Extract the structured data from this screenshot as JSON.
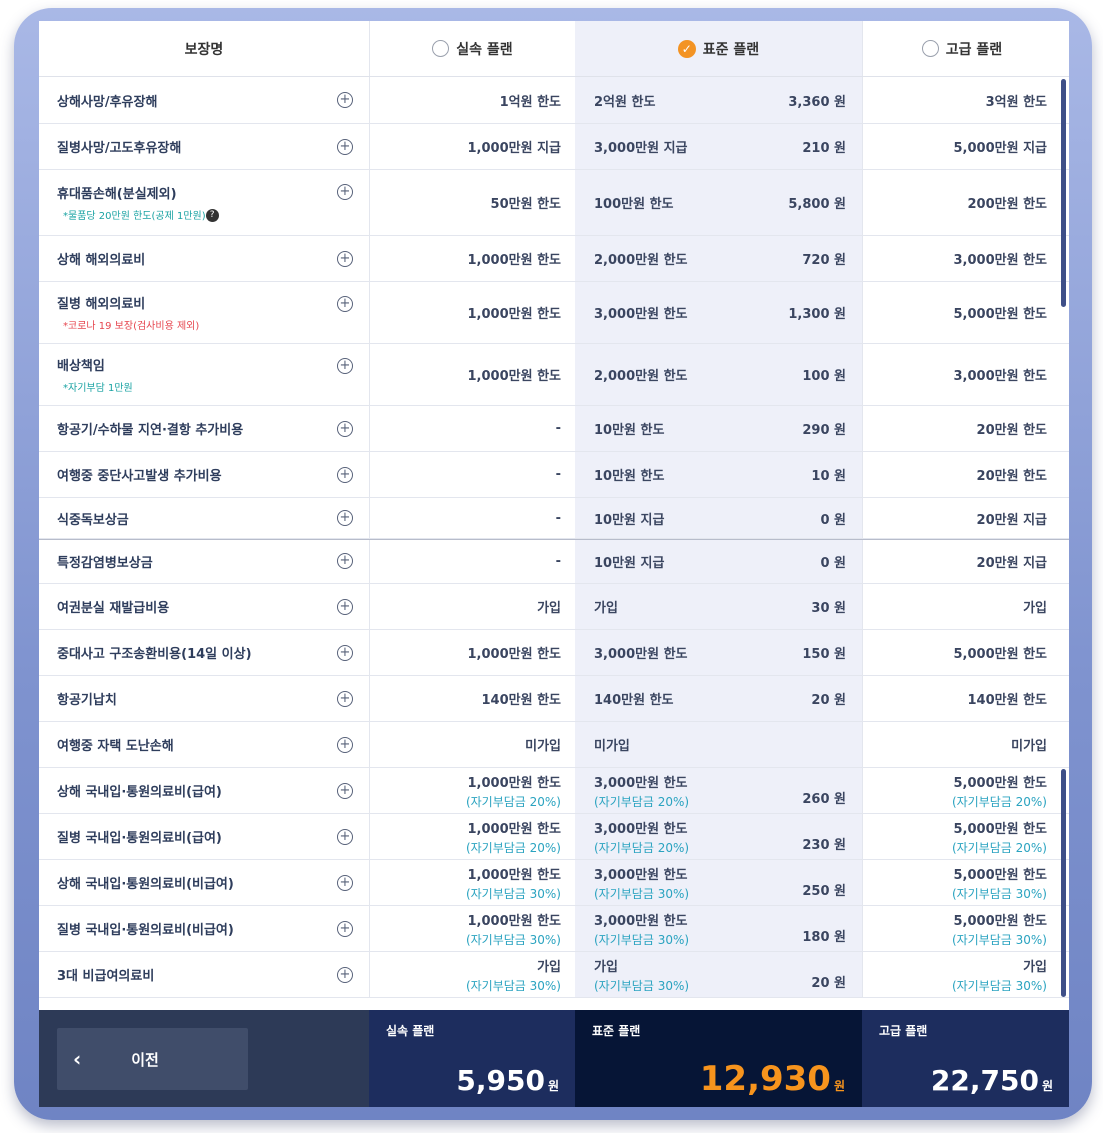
{
  "header": {
    "col0": "보장명",
    "plans": [
      {
        "label": "실속 플랜",
        "selected": false
      },
      {
        "label": "표준 플랜",
        "selected": true
      },
      {
        "label": "고급 플랜",
        "selected": false
      }
    ]
  },
  "rows": [
    {
      "name": "상해사망/후유장해",
      "c1": "1억원 한도",
      "c2": "2억원 한도",
      "price": "3,360 원",
      "c3": "3억원 한도"
    },
    {
      "name": "질병사망/고도후유장해",
      "c1": "1,000만원 지급",
      "c2": "3,000만원 지급",
      "price": "210 원",
      "c3": "5,000만원 지급"
    },
    {
      "name": "휴대품손해(분실제외)",
      "sub": "*물품당 20만원 한도(공제 1만원)",
      "subType": "teal",
      "c1": "50만원 한도",
      "c2": "100만원 한도",
      "price": "5,800 원",
      "c3": "200만원 한도"
    },
    {
      "name": "상해 해외의료비",
      "c1": "1,000만원 한도",
      "c2": "2,000만원 한도",
      "price": "720 원",
      "c3": "3,000만원 한도"
    },
    {
      "name": "질병 해외의료비",
      "sub": "*코로나 19 보장(검사비용 제외)",
      "subType": "red",
      "c1": "1,000만원 한도",
      "c2": "3,000만원 한도",
      "price": "1,300 원",
      "c3": "5,000만원 한도"
    },
    {
      "name": "배상책임",
      "sub": "*자기부담 1만원",
      "subType": "teal",
      "c1": "1,000만원 한도",
      "c2": "2,000만원 한도",
      "price": "100 원",
      "c3": "3,000만원 한도"
    },
    {
      "name": "항공기/수하물 지연·결항 추가비용",
      "c1": "-",
      "c2": "10만원 한도",
      "price": "290 원",
      "c3": "20만원 한도"
    },
    {
      "name": "여행중 중단사고발생 추가비용",
      "c1": "-",
      "c2": "10만원 한도",
      "price": "10 원",
      "c3": "20만원 한도"
    },
    {
      "name": "식중독보상금",
      "c1": "-",
      "c2": "10만원 지급",
      "price": "0 원",
      "c3": "20만원 지급"
    },
    {
      "name": "특정감염병보상금",
      "c1": "-",
      "c2": "10만원 지급",
      "price": "0 원",
      "c3": "20만원 지급"
    },
    {
      "name": "여권분실 재발급비용",
      "c1": "가입",
      "c2": "가입",
      "price": "30 원",
      "c3": "가입"
    },
    {
      "name": "중대사고 구조송환비용(14일 이상)",
      "c1": "1,000만원 한도",
      "c2": "3,000만원 한도",
      "price": "150 원",
      "c3": "5,000만원 한도"
    },
    {
      "name": "항공기납치",
      "c1": "140만원 한도",
      "c2": "140만원 한도",
      "price": "20 원",
      "c3": "140만원 한도"
    },
    {
      "name": "여행중 자택 도난손해",
      "c1": "미가입",
      "c2": "미가입",
      "price": "",
      "c3": "미가입"
    },
    {
      "name": "상해 국내입·통원의료비(급여)",
      "c1": "1,000만원 한도",
      "c1s": "(자기부담금 20%)",
      "c2": "3,000만원 한도",
      "c2s": "(자기부담금 20%)",
      "price": "260 원",
      "c3": "5,000만원 한도",
      "c3s": "(자기부담금 20%)"
    },
    {
      "name": "질병 국내입·통원의료비(급여)",
      "c1": "1,000만원 한도",
      "c1s": "(자기부담금 20%)",
      "c2": "3,000만원 한도",
      "c2s": "(자기부담금 20%)",
      "price": "230 원",
      "c3": "5,000만원 한도",
      "c3s": "(자기부담금 20%)"
    },
    {
      "name": "상해 국내입·통원의료비(비급여)",
      "c1": "1,000만원 한도",
      "c1s": "(자기부담금 30%)",
      "c2": "3,000만원 한도",
      "c2s": "(자기부담금 30%)",
      "price": "250 원",
      "c3": "5,000만원 한도",
      "c3s": "(자기부담금 30%)"
    },
    {
      "name": "질병 국내입·통원의료비(비급여)",
      "c1": "1,000만원 한도",
      "c1s": "(자기부담금 30%)",
      "c2": "3,000만원 한도",
      "c2s": "(자기부담금 30%)",
      "price": "180 원",
      "c3": "5,000만원 한도",
      "c3s": "(자기부담금 30%)"
    },
    {
      "name": "3대 비급여의료비",
      "c1": "가입",
      "c1s": "(자기부담금 30%)",
      "c2": "가입",
      "c2s": "(자기부담금 30%)",
      "price": "20 원",
      "c3": "가입",
      "c3s": "(자기부담금 30%)"
    }
  ],
  "footer": {
    "prev_label": "이전",
    "plans": [
      {
        "name": "실속 플랜",
        "amount": "5,950",
        "unit": "원"
      },
      {
        "name": "표준 플랜",
        "amount": "12,930",
        "unit": "원"
      },
      {
        "name": "고급 플랜",
        "amount": "22,750",
        "unit": "원"
      }
    ]
  }
}
